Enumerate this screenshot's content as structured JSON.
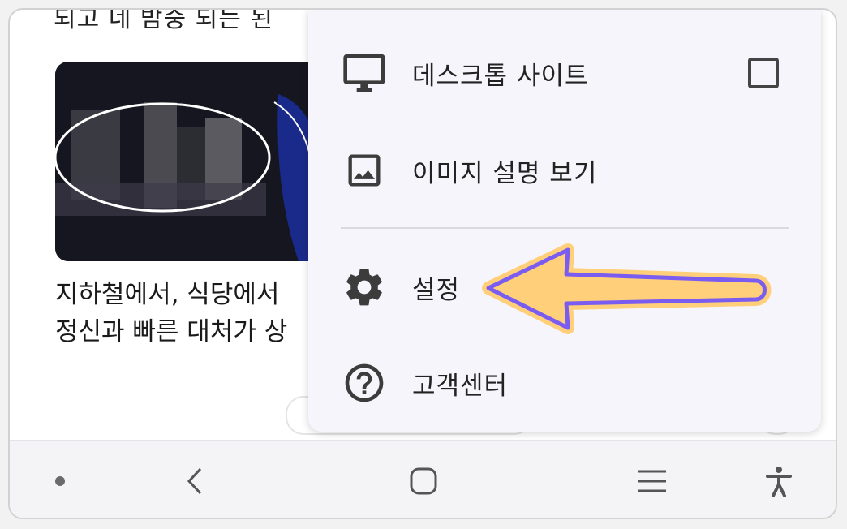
{
  "article": {
    "top_line": "되고 네 밤중 되는 된",
    "headline_line1": "지하철에서, 식당에서",
    "headline_line2": "정신과 빠른 대처가 상"
  },
  "menu": {
    "items": [
      {
        "label": "데스크톱 사이트",
        "icon": "monitor-icon",
        "has_checkbox": true,
        "checked": false
      },
      {
        "label": "이미지 설명 보기",
        "icon": "image-icon"
      },
      {
        "label": "설정",
        "icon": "gear-icon",
        "highlighted": true
      },
      {
        "label": "고객센터",
        "icon": "help-icon"
      }
    ]
  },
  "navbar": {
    "buttons": [
      "dot-icon",
      "back-icon",
      "home-icon",
      "recents-icon",
      "accessibility-icon"
    ]
  },
  "colors": {
    "menu_bg": "#f6f5fb",
    "arrow_fill": "#ffcf7a",
    "arrow_stroke": "#7b5cf0",
    "icon": "#3c3c3c"
  }
}
